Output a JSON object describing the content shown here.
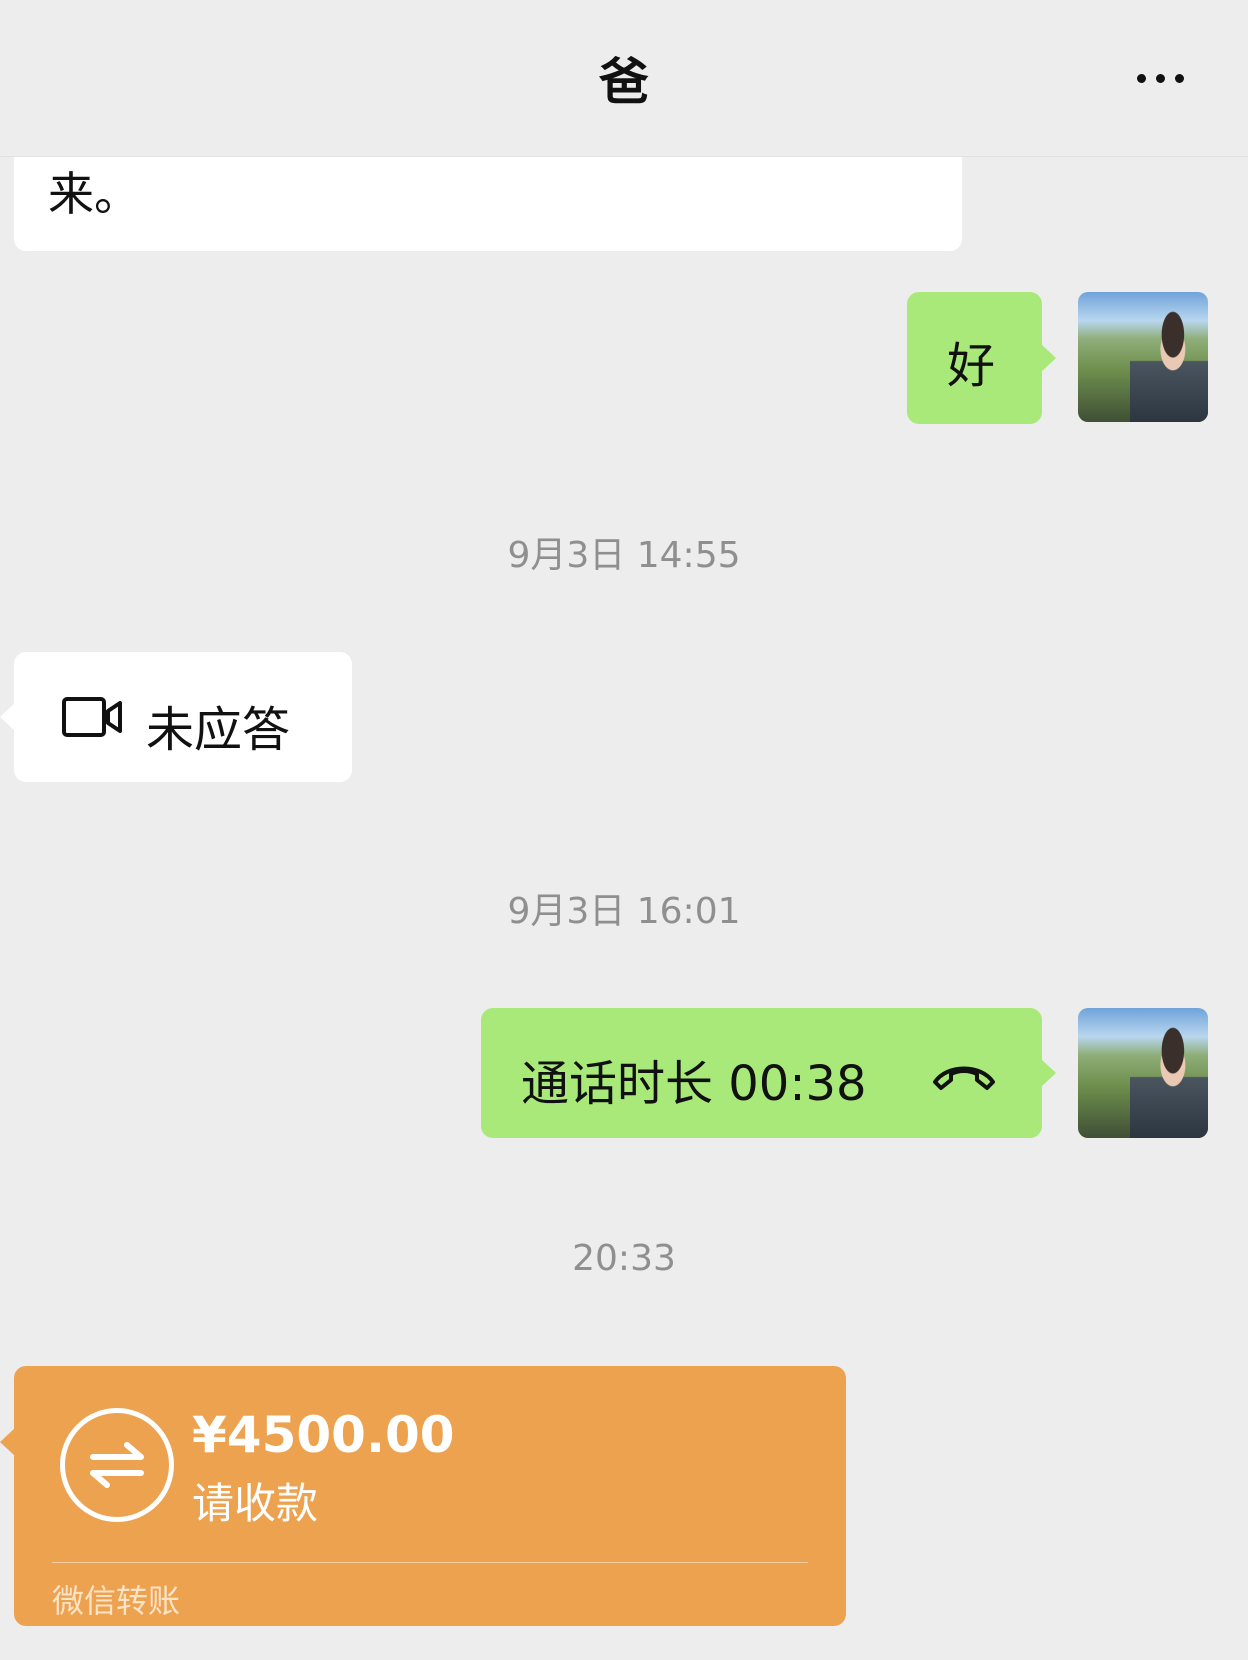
{
  "header": {
    "title": "爸",
    "more_icon": "more-dots-icon"
  },
  "messages": {
    "partial_received": {
      "text": "来。"
    },
    "sent_ok": {
      "text": "好"
    },
    "time_1": "9月3日 14:55",
    "missed_call": {
      "text": "未应答",
      "icon": "video-call-icon"
    },
    "time_2": "9月3日 16:01",
    "call_record": {
      "text": "通话时长 00:38",
      "icon": "phone-hangup-icon"
    },
    "time_3": "20:33",
    "transfer": {
      "amount": "¥4500.00",
      "status": "请收款",
      "brand": "微信转账",
      "icon": "transfer-arrows-icon"
    }
  },
  "colors": {
    "background": "#ededed",
    "sent_bubble": "#a9e97a",
    "received_bubble": "#ffffff",
    "transfer_card": "#eda250",
    "timestamp": "#8f8f8f"
  }
}
